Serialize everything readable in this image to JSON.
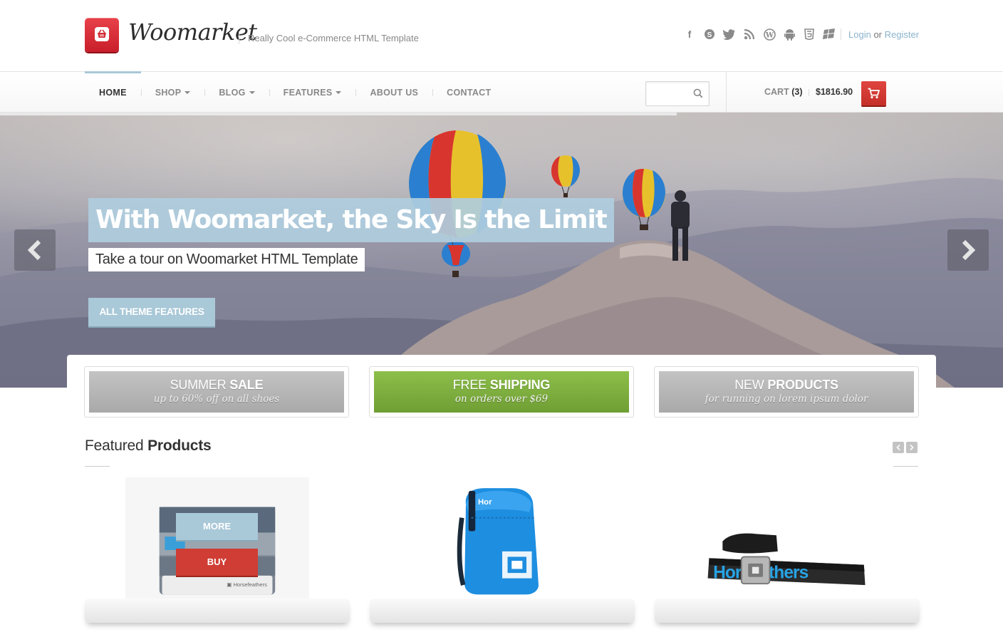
{
  "brand": {
    "name": "Woomarket",
    "tagline": "Really Cool e-Commerce HTML Template",
    "accent": "#cf3d34",
    "highlight": "#a9c8d8"
  },
  "header": {
    "socials": [
      "facebook-icon",
      "skype-icon",
      "twitter-icon",
      "rss-icon",
      "wordpress-icon",
      "android-icon",
      "html5-icon",
      "windows-icon"
    ],
    "login": "Login",
    "or": "or",
    "register": "Register"
  },
  "nav": {
    "items": [
      {
        "label": "HOME",
        "active": true,
        "dropdown": false
      },
      {
        "label": "SHOP",
        "active": false,
        "dropdown": true
      },
      {
        "label": "BLOG",
        "active": false,
        "dropdown": true
      },
      {
        "label": "FEATURES",
        "active": false,
        "dropdown": true
      },
      {
        "label": "ABOUT US",
        "active": false,
        "dropdown": false
      },
      {
        "label": "CONTACT",
        "active": false,
        "dropdown": false
      }
    ],
    "search_placeholder": "",
    "cart_label": "CART",
    "cart_count": "(3)",
    "cart_total": "$1816.90"
  },
  "hero": {
    "title": "With Woomarket, the Sky Is the Limit",
    "subtitle": "Take a tour on Woomarket HTML Template",
    "button": "ALL THEME FEATURES"
  },
  "promos": [
    {
      "title_light": "SUMMER",
      "title_bold": "SALE",
      "subtitle": "up to 60% off on all shoes",
      "color": "#b5b5b5"
    },
    {
      "title_light": "FREE",
      "title_bold": "SHIPPING",
      "subtitle": "on orders over $69",
      "color": "#7eaf3f"
    },
    {
      "title_light": "NEW",
      "title_bold": "PRODUCTS",
      "subtitle": "for running on lorem ipsum dolor",
      "color": "#b5b5b5"
    }
  ],
  "featured": {
    "title_light": "Featured",
    "title_bold": "Products",
    "products": [
      {
        "name": "wallet",
        "more": "MORE",
        "buy": "BUY"
      },
      {
        "name": "backpack"
      },
      {
        "name": "belt"
      }
    ]
  }
}
